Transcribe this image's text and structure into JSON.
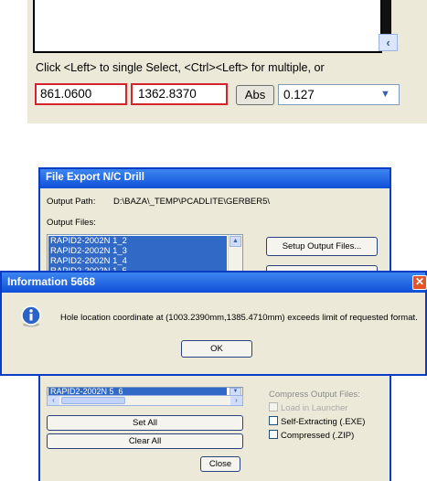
{
  "status_panel": {
    "hint": "Click <Left> to single Select, <Ctrl><Left> for multiple, or",
    "coord_x": "861.0600",
    "coord_y": "1362.8370",
    "abs_label": "Abs",
    "grid_value": "0.127"
  },
  "export_dialog": {
    "title": "File Export N/C Drill",
    "output_path_label": "Output Path:",
    "output_path_value": "D:\\BAZA\\_TEMP\\PCADLITE\\GERBER5\\",
    "output_files_label": "Output Files:",
    "output_files": [
      "RAPID2-2002N 1_2",
      "RAPID2-2002N 1_3",
      "RAPID2-2002N 1_4",
      "RAPID2-2002N 1_5"
    ],
    "lower_files": [
      "RAPID2-2002N 5_6"
    ],
    "setup_button": "Setup Output Files...",
    "set_all_button": "Set All",
    "clear_all_button": "Clear All",
    "close_button": "Close",
    "compress_label": "Compress Output Files:",
    "options": [
      {
        "label": "Load in Launcher",
        "checked": false,
        "disabled": true
      },
      {
        "label": "Self-Extracting (.EXE)",
        "checked": false,
        "disabled": false
      },
      {
        "label": "Compressed (.ZIP)",
        "checked": false,
        "disabled": false
      }
    ]
  },
  "info_dialog": {
    "title": "Information  5668",
    "message": "Hole location coordinate at (1003.2390mm,1385.4710mm) exceeds limit of requested format.",
    "ok_button": "OK"
  },
  "colors": {
    "xp_title_blue": "#0f4fd8",
    "xp_face": "#ece9d8",
    "selection_blue": "#3169c6",
    "highlight_red": "#d4252c",
    "close_orange": "#e2552b"
  },
  "icons": [
    "info-icon",
    "close-icon",
    "chevron-down-icon",
    "scroll-left-arrow-icon",
    "scroll-up-arrow-icon"
  ]
}
